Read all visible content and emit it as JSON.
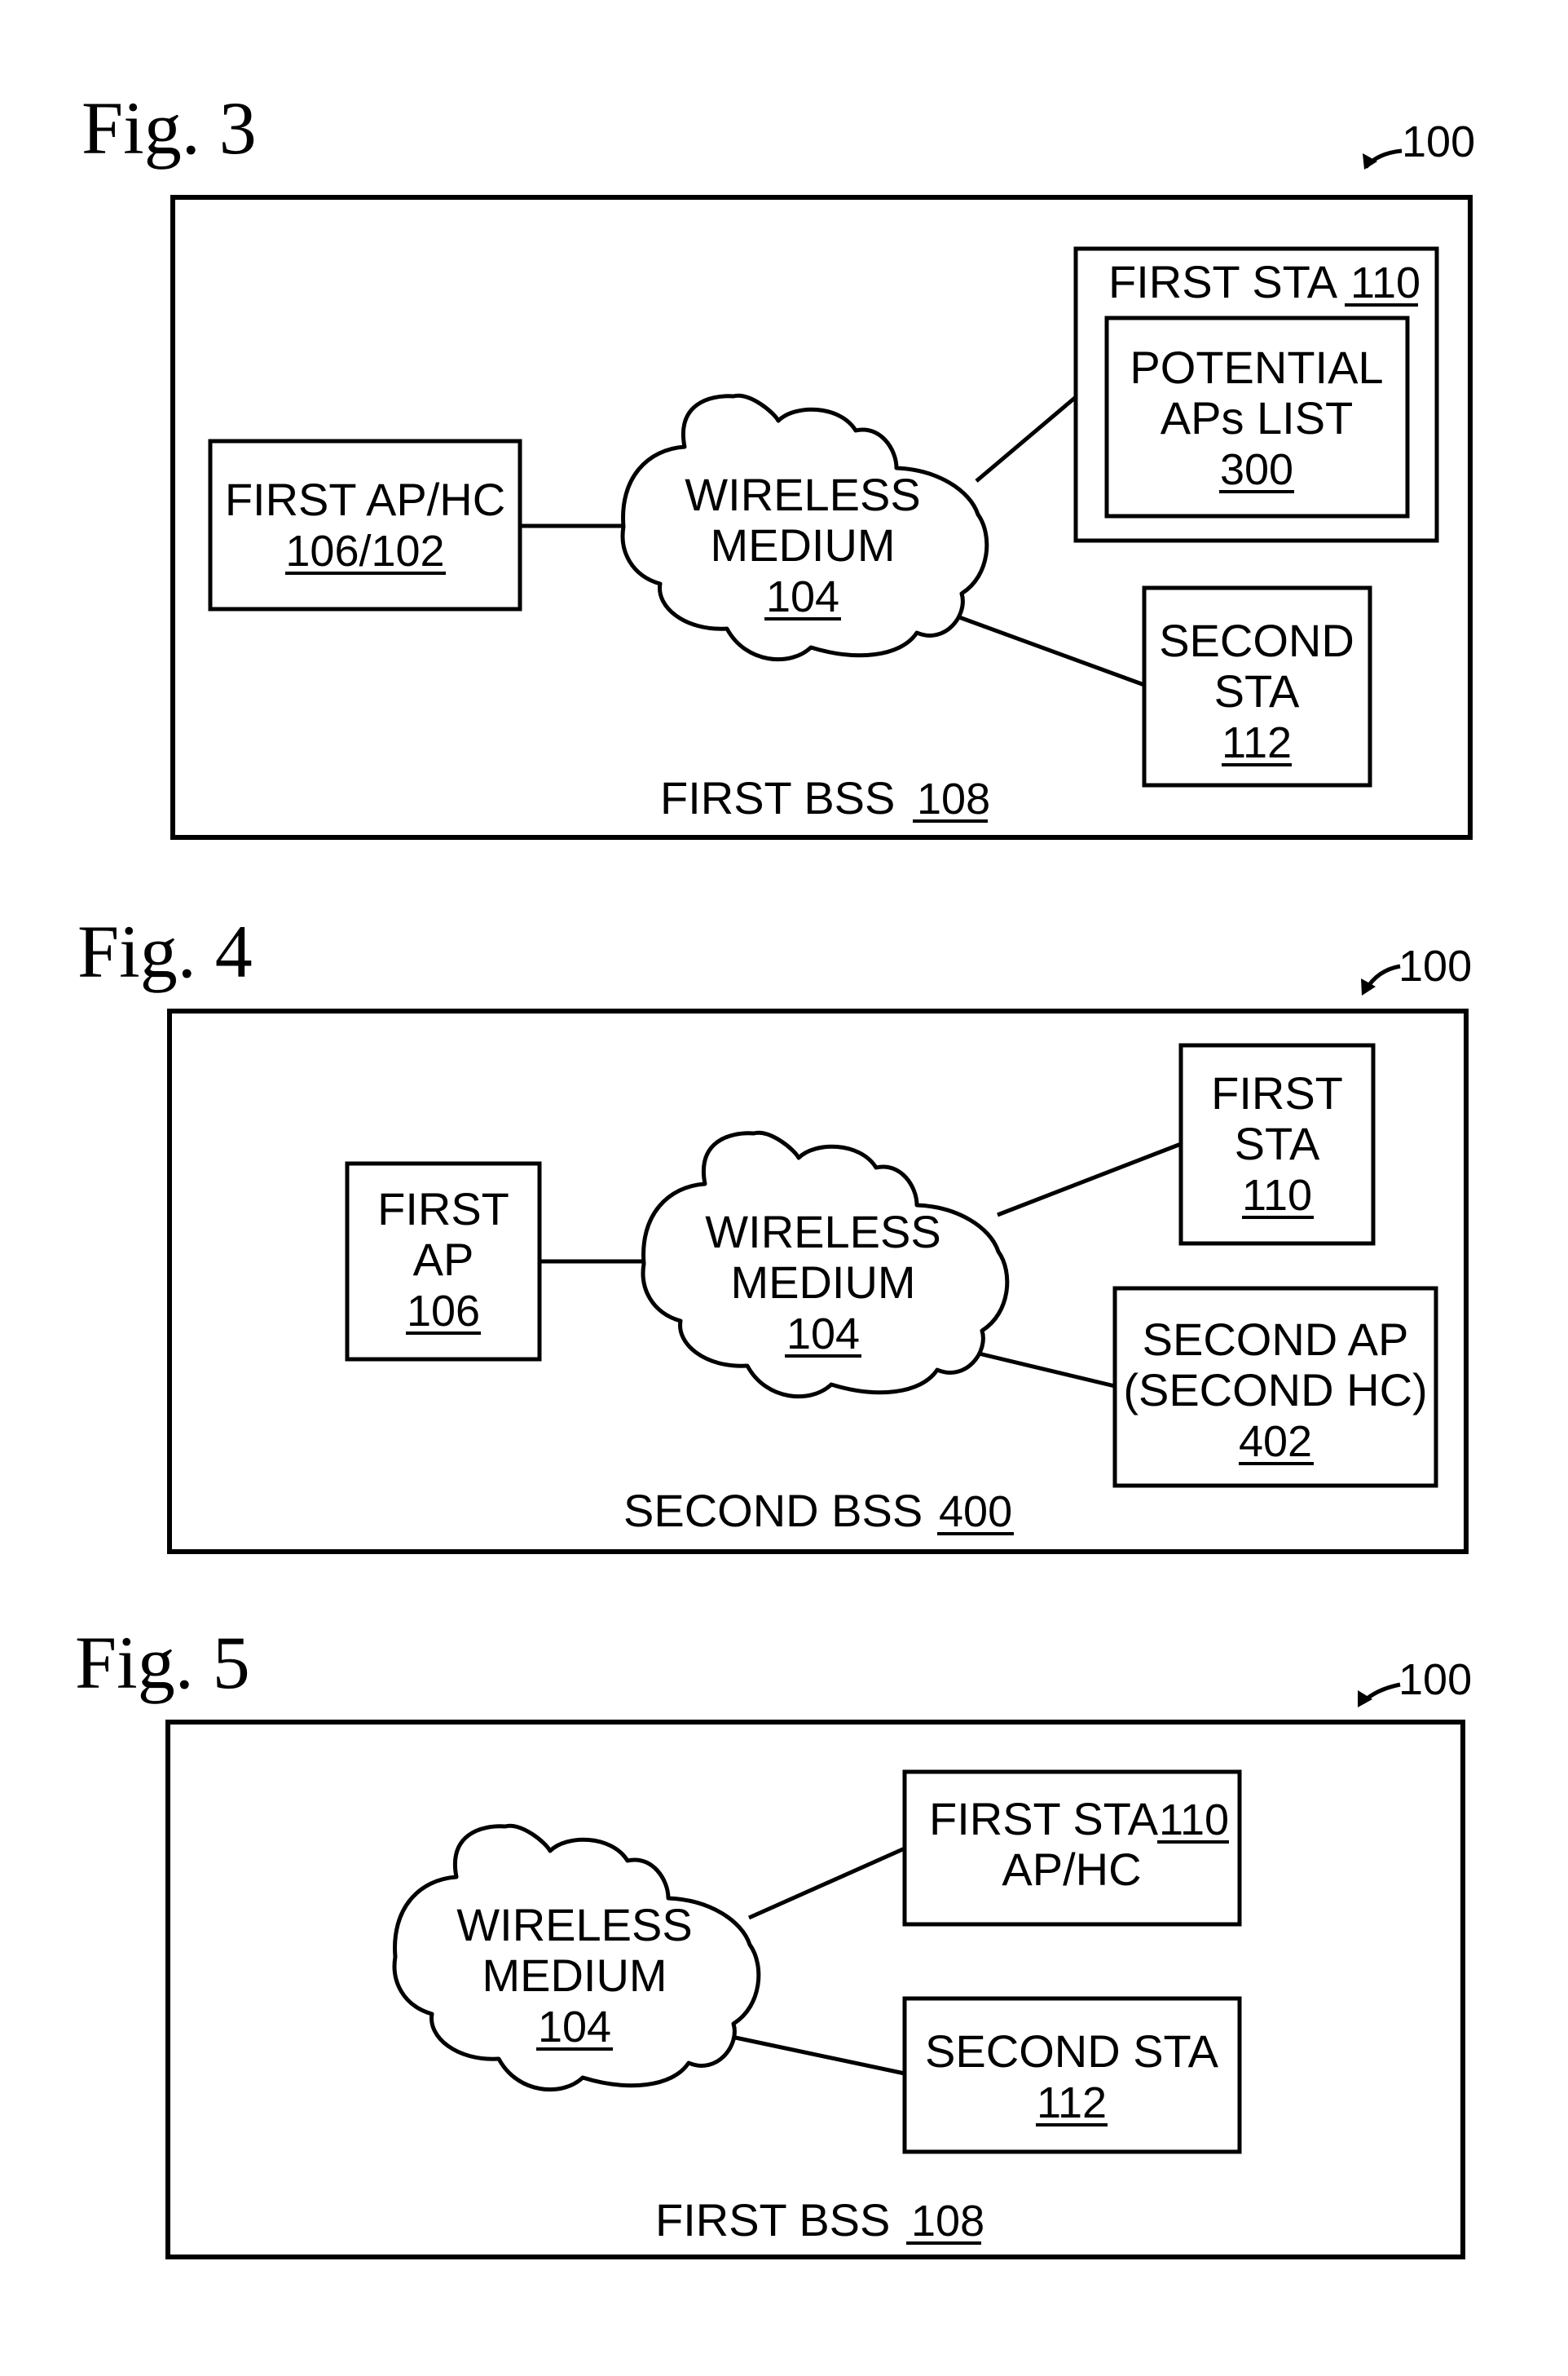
{
  "colors": {
    "ink": "#000000",
    "background": "#ffffff"
  },
  "figures": [
    {
      "title": "Fig. 3",
      "ref_label": "100",
      "bss": {
        "text": "FIRST BSS",
        "ref": "108"
      },
      "nodes": {
        "ap": {
          "lines": [
            "FIRST AP/HC"
          ],
          "ref": "106/102"
        },
        "cloud": {
          "lines": [
            "WIRELESS",
            "MEDIUM"
          ],
          "ref": "104"
        },
        "sta1": {
          "text": "FIRST STA",
          "ref": "110"
        },
        "list": {
          "lines": [
            "POTENTIAL",
            "APs LIST"
          ],
          "ref": "300"
        },
        "sta2": {
          "lines": [
            "SECOND",
            "STA"
          ],
          "ref": "112"
        }
      }
    },
    {
      "title": "Fig. 4",
      "ref_label": "100",
      "bss": {
        "text": "SECOND BSS",
        "ref": "400"
      },
      "nodes": {
        "ap": {
          "lines": [
            "FIRST",
            "AP"
          ],
          "ref": "106"
        },
        "cloud": {
          "lines": [
            "WIRELESS",
            "MEDIUM"
          ],
          "ref": "104"
        },
        "sta1": {
          "lines": [
            "FIRST",
            "STA"
          ],
          "ref": "110"
        },
        "ap2": {
          "lines": [
            "SECOND AP",
            "(SECOND HC)"
          ],
          "ref": "402"
        }
      }
    },
    {
      "title": "Fig. 5",
      "ref_label": "100",
      "bss": {
        "text": "FIRST BSS",
        "ref": "108"
      },
      "nodes": {
        "cloud": {
          "lines": [
            "WIRELESS",
            "MEDIUM"
          ],
          "ref": "104"
        },
        "sta1": {
          "text": "FIRST STA",
          "ref": "110",
          "line2": "AP/HC"
        },
        "sta2": {
          "lines": [
            "SECOND STA"
          ],
          "ref": "112"
        }
      }
    }
  ]
}
